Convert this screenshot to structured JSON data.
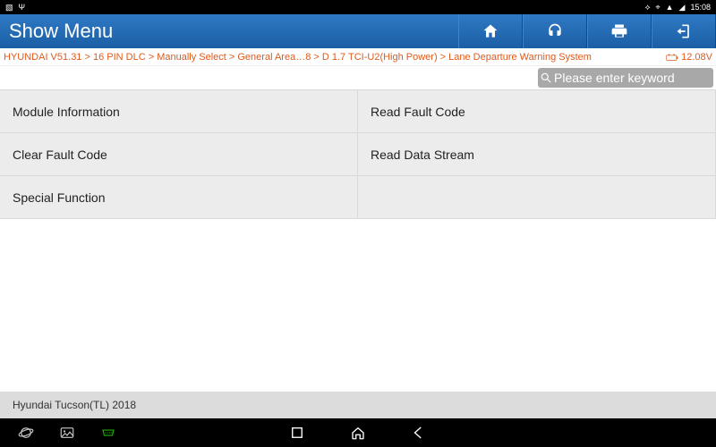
{
  "status": {
    "time": "15:08"
  },
  "title": "Show Menu",
  "breadcrumb": "HYUNDAI V51.31 > 16 PIN DLC > Manually Select > General Area…8 > D 1.7 TCI-U2(High Power) > Lane Departure Warning System",
  "voltage": "12.08V",
  "search": {
    "placeholder": "Please enter keyword"
  },
  "menu": {
    "r0c0": "Module Information",
    "r0c1": "Read Fault Code",
    "r1c0": "Clear Fault Code",
    "r1c1": "Read Data Stream",
    "r2c0": "Special Function"
  },
  "vehicle": "Hyundai Tucson(TL) 2018"
}
